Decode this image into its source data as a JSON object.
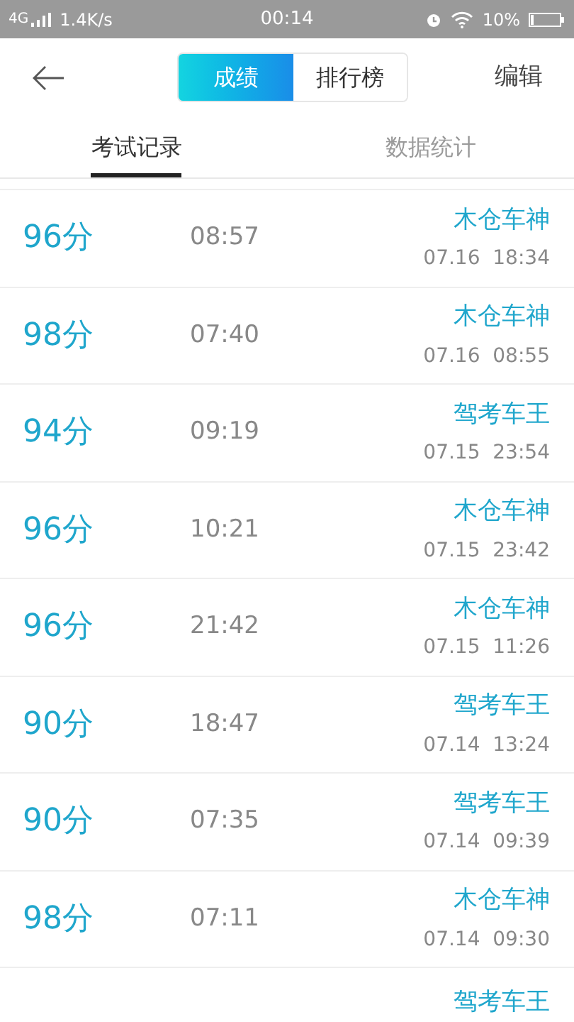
{
  "status_bar": {
    "network": "4G",
    "speed": "1.4K/s",
    "time": "00:14",
    "battery": "10%"
  },
  "header": {
    "segments": [
      {
        "label": "成绩",
        "selected": true
      },
      {
        "label": "排行榜",
        "selected": false
      }
    ],
    "action": "编辑"
  },
  "tabs": [
    {
      "label": "考试记录",
      "selected": true
    },
    {
      "label": "数据统计",
      "selected": false
    }
  ],
  "records": [
    {
      "score": "96分",
      "duration": "08:57",
      "name": "木仓车神",
      "date": "07.16  18:34"
    },
    {
      "score": "98分",
      "duration": "07:40",
      "name": "木仓车神",
      "date": "07.16  08:55"
    },
    {
      "score": "94分",
      "duration": "09:19",
      "name": "驾考车王",
      "date": "07.15  23:54"
    },
    {
      "score": "96分",
      "duration": "10:21",
      "name": "木仓车神",
      "date": "07.15  23:42"
    },
    {
      "score": "96分",
      "duration": "21:42",
      "name": "木仓车神",
      "date": "07.15  11:26"
    },
    {
      "score": "90分",
      "duration": "18:47",
      "name": "驾考车王",
      "date": "07.14  13:24"
    },
    {
      "score": "90分",
      "duration": "07:35",
      "name": "驾考车王",
      "date": "07.14  09:39"
    },
    {
      "score": "98分",
      "duration": "07:11",
      "name": "木仓车神",
      "date": "07.14  09:30"
    },
    {
      "name": "驾考车王"
    }
  ]
}
